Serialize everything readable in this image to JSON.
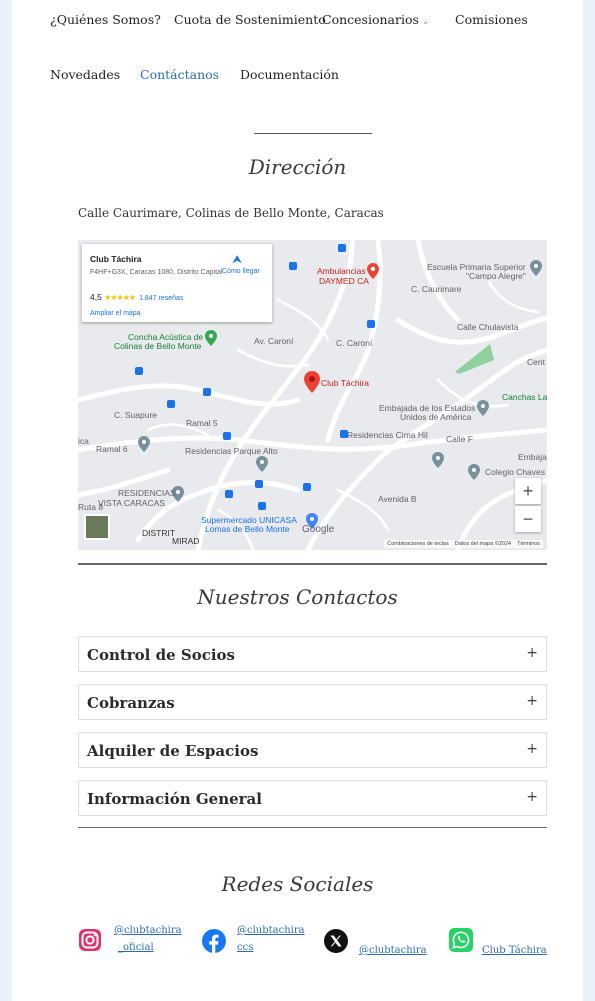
{
  "nav": {
    "items": [
      {
        "label": "¿Quiénes Somos?"
      },
      {
        "label": "Cuota de Sostenimiento"
      },
      {
        "label": "Concesionarios"
      },
      {
        "label": "Comisiones"
      },
      {
        "label": "Novedades"
      },
      {
        "label": "Contáctanos"
      },
      {
        "label": "Documentación"
      }
    ],
    "caret": "⌄"
  },
  "direccion": {
    "title": "Dirección",
    "address": "Calle Caurimare, Colinas de Bello Monte, Caracas"
  },
  "map": {
    "card": {
      "name": "Club Táchira",
      "address": "F4HF+G3X, Caracas 1080, Distrito Capital",
      "rating": "4,5",
      "stars": "★★★★★",
      "reviews": "1.847 reseñas",
      "enlarge": "Ampliar el mapa",
      "route": "Cómo llegar"
    },
    "labels": {
      "ambulancias": "Ambulancias",
      "daymed": "DAYMED CA",
      "escuela1": "Escuela Primaria Superior",
      "escuela2": "\"Campo Alegre\"",
      "concha1": "Concha Acústica de",
      "concha2": "Colinas de Bello Monte",
      "club": "Club Táchira",
      "embajada1": "Embajada de los Estados",
      "embajada2": "Unidos de América",
      "canchas": "Canchas La",
      "ramal6": "Ramal 6",
      "residencias_pa": "Residencias Parque Alto",
      "residencias_ch": "Residencias Cima Hil",
      "colegio": "Colegio Chaves",
      "residencias_vc1": "RESIDENCIAS",
      "residencias_vc2": "VISTA CARACAS",
      "super1": "Supermercado UNICASA",
      "super2": "Lomas de Bello Monte",
      "embaj_r": "Embajad",
      "cent": "Cent",
      "ica": "ica",
      "ruta8": "Ruta 8",
      "ramal5": "Ramal 5",
      "calle_chulavista": "Calle Chulavista",
      "calle_caroni": "C. Caroní",
      "av_caroni": "Av. Caroní",
      "c_suapure": "C. Suapure",
      "calle_f": "Calle F",
      "avenida_b": "Avenida B",
      "c_caurimare": "C. Caurimare",
      "distrit": "DISTRIT",
      "mirad": "MIRAD",
      "google": "Google"
    },
    "zoom_in": "+",
    "zoom_out": "−",
    "footer": {
      "shortcuts": "Combinaciones de teclas",
      "data": "Datos del mapa ©2024",
      "terms": "Términos"
    }
  },
  "contactos": {
    "title": "Nuestros Contactos",
    "items": [
      {
        "label": "Control de Socios",
        "icon": "+"
      },
      {
        "label": "Cobranzas",
        "icon": "+"
      },
      {
        "label": "Alquiler de Espacios",
        "icon": "+"
      },
      {
        "label": "Información General",
        "icon": "+"
      }
    ]
  },
  "redes": {
    "title": "Redes Sociales",
    "instagram": {
      "line1": "@clubtachira",
      "line2": "_oficial"
    },
    "facebook": {
      "line1": "@clubtachira",
      "line2": "ccs"
    },
    "x": {
      "line1": "@clubtachira"
    },
    "whatsapp": {
      "line1": "Club Táchira"
    }
  },
  "colors": {
    "accent": "#2b6cb0",
    "instagram": "#e1306c",
    "facebook": "#1877f2",
    "whatsapp": "#25d366"
  }
}
